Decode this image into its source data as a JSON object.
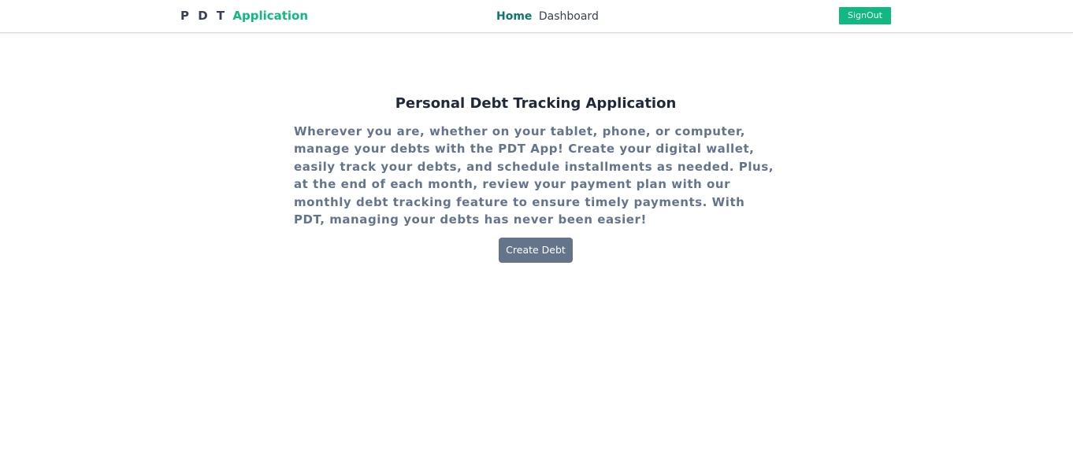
{
  "navbar": {
    "brand_prefix": "P D T",
    "brand_suffix": "Application",
    "links": {
      "home": "Home",
      "dashboard": "Dashboard"
    },
    "signout_label": "SignOut"
  },
  "hero": {
    "title": "Personal Debt Tracking Application",
    "description": "Wherever you are, whether on your tablet, phone, or computer, manage your debts with the PDT App! Create your digital wallet, easily track your debts, and schedule installments as needed. Plus, at the end of each month, review your payment plan with our monthly debt tracking feature to ensure timely payments. With PDT, managing your debts has never been easier!",
    "button_label": "Create Debt"
  },
  "colors": {
    "brand_green": "#10b981",
    "home_link": "#0f766e",
    "text_dark": "#1f2937",
    "text_muted": "#64748b",
    "button_gray": "#64748b"
  }
}
